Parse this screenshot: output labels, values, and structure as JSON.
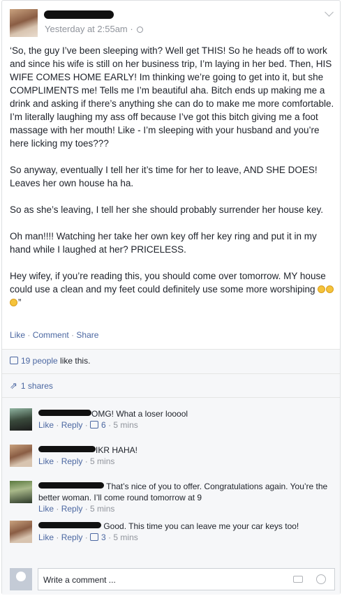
{
  "post": {
    "timestamp": "Yesterday at 2:55am",
    "paragraphs": [
      "‘So, the guy I’ve been sleeping with? Well get THIS! So he heads off to work and since his wife is still on her business trip, I’m laying in her bed. Then, HIS WIFE COMES HOME EARLY! Im thinking we’re going to get into it, but she COMPLIMENTS me! Tells me I’m beautiful aha. Bitch ends up making me a drink and asking if there’s anything she can do to make me more comfortable. I’m literally laughing my ass off because I’ve got this bitch giving me a foot massage with her mouth! Like - I’m sleeping with your husband and you’re here licking my toes???",
      "So anyway, eventually I tell her it’s time for her to leave, AND SHE DOES! Leaves her own house ha ha.",
      "So as she’s leaving, I tell her she should probably surrender her house key.",
      "Oh man!!!! Watching her take her own key off her key ring and put it in my hand while I laughed at her? PRICELESS."
    ],
    "last_paragraph": "Hey wifey, if you’re reading this, you should come over tomorrow. MY house could use a clean and my feet could definitely use some more worshiping",
    "last_paragraph_end": "”",
    "actions": {
      "like": "Like",
      "comment": "Comment",
      "share": "Share"
    }
  },
  "reactions": {
    "likes_count": "19 people",
    "likes_suffix": " like this.",
    "shares": "1 shares"
  },
  "comments": [
    {
      "text": "OMG! What a loser looool",
      "meta_like": "Like",
      "meta_reply": "Reply",
      "likes": "6",
      "time": "5 mins"
    },
    {
      "text": "IKR HAHA!",
      "meta_like": "Like",
      "meta_reply": "Reply",
      "likes": "",
      "time": "5 mins"
    },
    {
      "text": "That’s nice of you to offer. Congratulations again. You’re the better woman. I’ll come round tomorrow at 9",
      "meta_like": "Like",
      "meta_reply": "Reply",
      "likes": "",
      "time": "5 mins"
    },
    {
      "text": "Good. This time you can leave me your car keys too!",
      "meta_like": "Like",
      "meta_reply": "Reply",
      "likes": "3",
      "time": "5 mins"
    }
  ],
  "composer": {
    "placeholder": "Write a comment ..."
  },
  "colors": {
    "link": "#4b67a1",
    "muted": "#90949c",
    "redaction": "#111111"
  }
}
